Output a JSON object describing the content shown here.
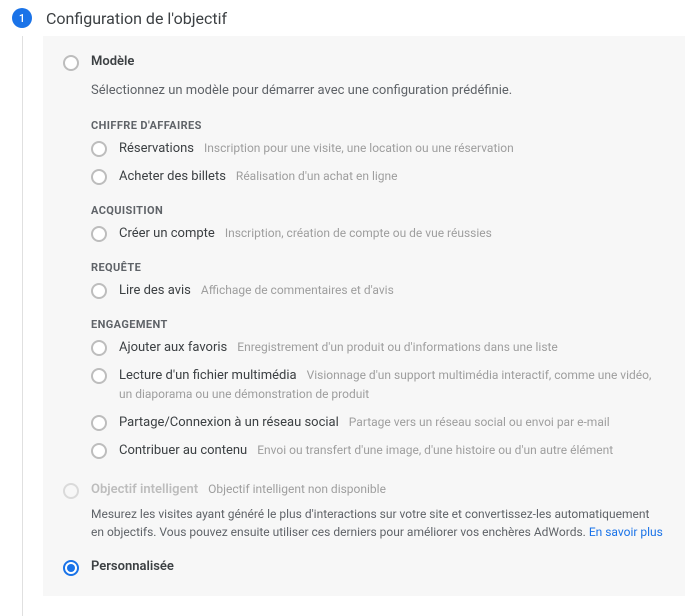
{
  "step": {
    "number": "1",
    "title": "Configuration de l'objectif"
  },
  "modelOption": {
    "label": "Modèle",
    "help": "Sélectionnez un modèle pour démarrer avec une configuration prédéfinie."
  },
  "categories": [
    {
      "title": "CHIFFRE D'AFFAIRES",
      "templates": [
        {
          "name": "Réservations",
          "desc": "Inscription pour une visite, une location ou une réservation"
        },
        {
          "name": "Acheter des billets",
          "desc": "Réalisation d'un achat en ligne"
        }
      ]
    },
    {
      "title": "ACQUISITION",
      "templates": [
        {
          "name": "Créer un compte",
          "desc": "Inscription, création de compte ou de vue réussies"
        }
      ]
    },
    {
      "title": "REQUÊTE",
      "templates": [
        {
          "name": "Lire des avis",
          "desc": "Affichage de commentaires et d'avis"
        }
      ]
    },
    {
      "title": "ENGAGEMENT",
      "templates": [
        {
          "name": "Ajouter aux favoris",
          "desc": "Enregistrement d'un produit ou d'informations dans une liste"
        },
        {
          "name": "Lecture d'un fichier multimédia",
          "desc": "Visionnage d'un support multimédia interactif, comme une vidéo, un diaporama ou une démonstration de produit"
        },
        {
          "name": "Partage/Connexion à un réseau social",
          "desc": "Partage vers un réseau social ou envoi par e-mail"
        },
        {
          "name": "Contribuer au contenu",
          "desc": "Envoi ou transfert d'une image, d'une histoire ou d'un autre élément"
        }
      ]
    }
  ],
  "smart": {
    "label": "Objectif intelligent",
    "hint": "Objectif intelligent non disponible",
    "desc": "Mesurez les visites ayant généré le plus d'interactions sur votre site et convertissez-les automatiquement en objectifs. Vous pouvez ensuite utiliser ces derniers pour améliorer vos enchères AdWords. ",
    "link": "En savoir plus"
  },
  "custom": {
    "label": "Personnalisée"
  }
}
